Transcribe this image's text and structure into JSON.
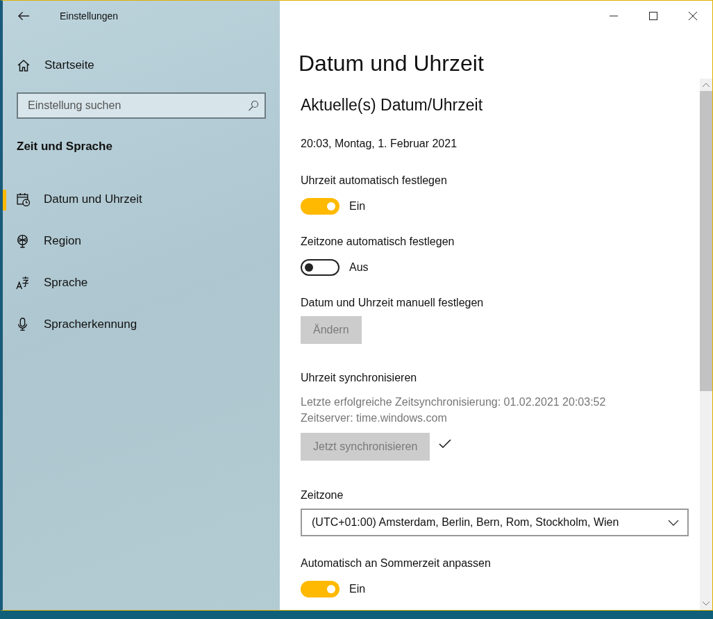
{
  "window": {
    "title": "Einstellungen"
  },
  "sidebar": {
    "home": "Startseite",
    "search": {
      "placeholder": "Einstellung suchen"
    },
    "section_title": "Zeit und Sprache",
    "items": [
      {
        "label": "Datum und Uhrzeit",
        "selected": true
      },
      {
        "label": "Region",
        "selected": false
      },
      {
        "label": "Sprache",
        "selected": false
      },
      {
        "label": "Spracherkennung",
        "selected": false
      }
    ]
  },
  "page_title": "Datum und Uhrzeit",
  "section_title": "Aktuelle(s) Datum/Uhrzeit",
  "current_time": "20:03, Montag, 1. Februar 2021",
  "settings": [
    {
      "kind": "toggle",
      "label": "Uhrzeit automatisch festlegen",
      "on": true,
      "state_text": "Ein"
    },
    {
      "kind": "toggle",
      "label": "Zeitzone automatisch festlegen",
      "on": false,
      "state_text": "Aus"
    },
    {
      "kind": "button",
      "label": "Datum und Uhrzeit manuell festlegen",
      "button": {
        "label": "Ändern",
        "disabled": true
      }
    },
    {
      "kind": "sync",
      "label": "Uhrzeit synchronisieren",
      "details": [
        "Letzte erfolgreiche Zeitsynchronisierung: 01.02.2021 20:03:52",
        "Zeitserver: time.windows.com"
      ],
      "button": {
        "label": "Jetzt synchronisieren",
        "disabled": true
      },
      "synced": true
    },
    {
      "kind": "dropdown",
      "label": "Zeitzone",
      "value": "(UTC+01:00) Amsterdam, Berlin, Bern, Rom, Stockholm, Wien"
    },
    {
      "kind": "toggle",
      "label": "Automatisch an Sommerzeit anpassen",
      "on": true,
      "state_text": "Ein"
    }
  ]
}
